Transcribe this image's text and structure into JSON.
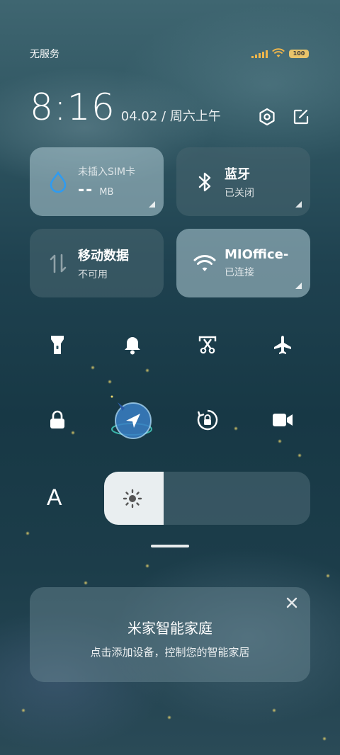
{
  "status_bar": {
    "carrier": "无服务",
    "battery": "100"
  },
  "header": {
    "time": "8:16",
    "date": "04.02 / 周六上午",
    "settings_icon": "gear-icon",
    "edit_icon": "edit-icon"
  },
  "tiles": {
    "data_usage": {
      "label": "未插入SIM卡",
      "value": "--",
      "unit": "MB",
      "icon": "drop-icon"
    },
    "bluetooth": {
      "title": "蓝牙",
      "status": "已关闭",
      "icon": "bluetooth-icon"
    },
    "mobile_data": {
      "title": "移动数据",
      "status": "不可用",
      "icon": "data-arrows-icon"
    },
    "wifi": {
      "title": "MIOffice-",
      "status": "已连接",
      "icon": "wifi-icon"
    }
  },
  "toggles_row1": [
    "flashlight-icon",
    "bell-icon",
    "screenshot-icon",
    "airplane-icon"
  ],
  "toggles_row2": [
    "lock-icon",
    "location-icon",
    "rotation-lock-icon",
    "video-icon"
  ],
  "brightness": {
    "auto_label": "A",
    "level": 0.29
  },
  "mijia": {
    "title": "米家智能家庭",
    "subtitle": "点击添加设备，控制您的智能家居"
  }
}
